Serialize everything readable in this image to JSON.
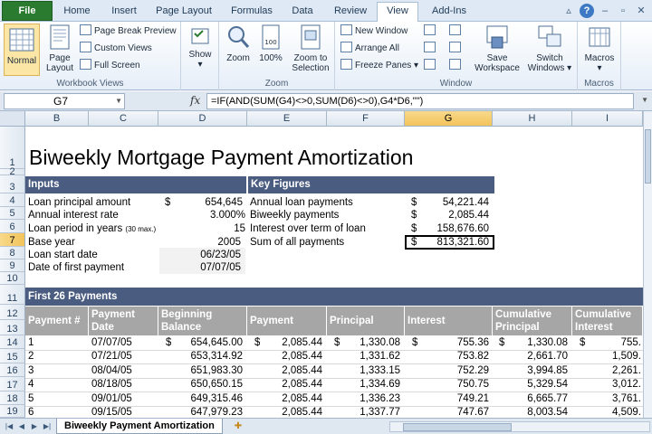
{
  "tabs": {
    "file": "File",
    "home": "Home",
    "insert": "Insert",
    "page_layout": "Page Layout",
    "formulas": "Formulas",
    "data": "Data",
    "review": "Review",
    "view": "View",
    "addins": "Add-Ins"
  },
  "ribbon": {
    "workbook_views": {
      "label": "Workbook Views",
      "normal": "Normal",
      "page_layout_1": "Page",
      "page_layout_2": "Layout",
      "page_break_preview": "Page Break Preview",
      "custom_views": "Custom Views",
      "full_screen": "Full Screen"
    },
    "show": {
      "label": "Show"
    },
    "zoom": {
      "label": "Zoom",
      "zoom": "Zoom",
      "zoom100": "100%",
      "zoom_to_selection_1": "Zoom to",
      "zoom_to_selection_2": "Selection",
      "icon_100": "100"
    },
    "window": {
      "label": "Window",
      "new_window": "New Window",
      "arrange_all": "Arrange All",
      "freeze_panes": "Freeze Panes",
      "save_workspace_1": "Save",
      "save_workspace_2": "Workspace",
      "switch_windows_1": "Switch",
      "switch_windows_2": "Windows"
    },
    "macros": {
      "label": "Macros",
      "macros": "Macros"
    }
  },
  "formula_bar": {
    "name_box": "G7",
    "fx": "fx",
    "formula": "=IF(AND(SUM(G4)<>0,SUM(D6)<>0),G4*D6,\"\")"
  },
  "columns": [
    "B",
    "C",
    "D",
    "E",
    "F",
    "G",
    "H",
    "I"
  ],
  "rows": [
    "1",
    "2",
    "3",
    "4",
    "5",
    "6",
    "7",
    "8",
    "9",
    "10",
    "11",
    "12",
    "13",
    "14",
    "15",
    "16",
    "17",
    "18",
    "19"
  ],
  "sheet": {
    "title": "Biweekly Mortgage Payment Amortization",
    "inputs": {
      "header": "Inputs",
      "loan_principal_label": "Loan principal amount",
      "loan_principal_cur": "$",
      "loan_principal_val": "654,645",
      "interest_rate_label": "Annual interest rate",
      "interest_rate_val": "3.000%",
      "loan_period_label": "Loan period in years",
      "loan_period_note": "(30 max.)",
      "loan_period_val": "15",
      "base_year_label": "Base year",
      "base_year_val": "2005",
      "loan_start_label": "Loan start date",
      "loan_start_val": "06/23/05",
      "first_payment_label": "Date of first payment",
      "first_payment_val": "07/07/05"
    },
    "key_figures": {
      "header": "Key Figures",
      "items": [
        {
          "label": "Annual loan payments",
          "cur": "$",
          "value": "54,221.44"
        },
        {
          "label": "Biweekly payments",
          "cur": "$",
          "value": "2,085.44"
        },
        {
          "label": "Interest over term of loan",
          "cur": "$",
          "value": "158,676.60"
        },
        {
          "label": "Sum of all payments",
          "cur": "$",
          "value": "813,321.60"
        }
      ]
    },
    "payments": {
      "header": "First 26 Payments",
      "columns": {
        "payment_no": "Payment #",
        "payment_date_1": "Payment",
        "payment_date_2": "Date",
        "beginning_balance_1": "Beginning",
        "beginning_balance_2": "Balance",
        "payment": "Payment",
        "principal": "Principal",
        "interest": "Interest",
        "cum_principal_1": "Cumulative",
        "cum_principal_2": "Principal",
        "cum_interest_1": "Cumulative",
        "cum_interest_2": "Interest"
      },
      "rows": [
        {
          "no": "1",
          "date": "07/07/05",
          "bal_cur": "$",
          "balance": "654,645.00",
          "pay_cur": "$",
          "payment": "2,085.44",
          "prin_cur": "$",
          "principal": "1,330.08",
          "int_cur": "$",
          "interest": "755.36",
          "cp_cur": "$",
          "cum_principal": "1,330.08",
          "ci_cur": "$",
          "cum_interest": "755."
        },
        {
          "no": "2",
          "date": "07/21/05",
          "bal_cur": "",
          "balance": "653,314.92",
          "pay_cur": "",
          "payment": "2,085.44",
          "prin_cur": "",
          "principal": "1,331.62",
          "int_cur": "",
          "interest": "753.82",
          "cp_cur": "",
          "cum_principal": "2,661.70",
          "ci_cur": "",
          "cum_interest": "1,509."
        },
        {
          "no": "3",
          "date": "08/04/05",
          "bal_cur": "",
          "balance": "651,983.30",
          "pay_cur": "",
          "payment": "2,085.44",
          "prin_cur": "",
          "principal": "1,333.15",
          "int_cur": "",
          "interest": "752.29",
          "cp_cur": "",
          "cum_principal": "3,994.85",
          "ci_cur": "",
          "cum_interest": "2,261."
        },
        {
          "no": "4",
          "date": "08/18/05",
          "bal_cur": "",
          "balance": "650,650.15",
          "pay_cur": "",
          "payment": "2,085.44",
          "prin_cur": "",
          "principal": "1,334.69",
          "int_cur": "",
          "interest": "750.75",
          "cp_cur": "",
          "cum_principal": "5,329.54",
          "ci_cur": "",
          "cum_interest": "3,012."
        },
        {
          "no": "5",
          "date": "09/01/05",
          "bal_cur": "",
          "balance": "649,315.46",
          "pay_cur": "",
          "payment": "2,085.44",
          "prin_cur": "",
          "principal": "1,336.23",
          "int_cur": "",
          "interest": "749.21",
          "cp_cur": "",
          "cum_principal": "6,665.77",
          "ci_cur": "",
          "cum_interest": "3,761."
        },
        {
          "no": "6",
          "date": "09/15/05",
          "bal_cur": "",
          "balance": "647,979.23",
          "pay_cur": "",
          "payment": "2,085.44",
          "prin_cur": "",
          "principal": "1,337.77",
          "int_cur": "",
          "interest": "747.67",
          "cp_cur": "",
          "cum_principal": "8,003.54",
          "ci_cur": "",
          "cum_interest": "4,509."
        }
      ]
    }
  },
  "sheet_tab": "Biweekly Payment Amortization"
}
